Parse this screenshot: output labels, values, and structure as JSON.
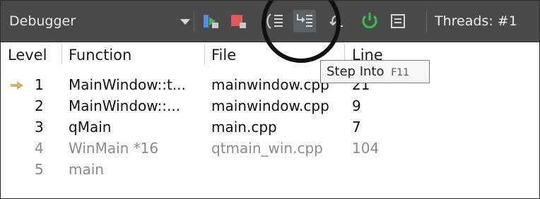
{
  "toolbar": {
    "view_selector": "Debugger",
    "threads_label": "Threads:",
    "threads_value": "#1",
    "buttons": [
      {
        "icon": "continue-icon"
      },
      {
        "icon": "stop-debugger-icon"
      },
      {
        "icon": "step-over-icon"
      },
      {
        "icon": "step-into-icon",
        "active": true
      },
      {
        "icon": "step-out-icon"
      },
      {
        "icon": "restart-debugging-icon"
      },
      {
        "icon": "operate-by-instruction-icon"
      }
    ]
  },
  "tooltip": {
    "text": "Step Into",
    "shortcut": "F11"
  },
  "stack": {
    "columns": [
      "Level",
      "Function",
      "File",
      "Line"
    ],
    "rows": [
      {
        "level": "1",
        "function": "MainWindow::t...",
        "file": "mainwindow.cpp",
        "line": "21",
        "current": true
      },
      {
        "level": "2",
        "function": "MainWindow::...",
        "file": "mainwindow.cpp",
        "line": "9"
      },
      {
        "level": "3",
        "function": "qMain",
        "file": "main.cpp",
        "line": "7"
      },
      {
        "level": "4",
        "function": "WinMain *16",
        "file": "qtmain_win.cpp",
        "line": "104",
        "dim": true
      },
      {
        "level": "5",
        "function": "main",
        "file": "",
        "line": "",
        "dim": true
      }
    ]
  },
  "colors": {
    "toolbar_bg": "#4a4a4a",
    "pointer": "#d9b25e",
    "power": "#3cbf4a",
    "stop": "#e05a55"
  }
}
